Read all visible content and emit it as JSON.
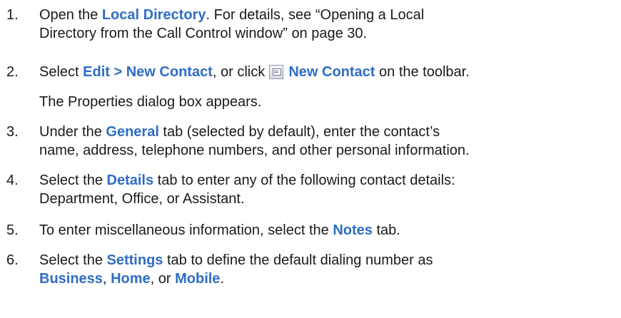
{
  "steps": [
    {
      "number": "1.",
      "lines": [
        [
          "Open the ",
          "Local Directory",
          ". For details, see “Opening a Local"
        ],
        [
          "Directory from the Call Control window” on page 30."
        ]
      ]
    },
    {
      "number": "2.",
      "text_a": "Select ",
      "ui_a": "Edit > New Contact",
      "text_b": ", or click ",
      "icon": "new-contact-icon",
      "ui_b": "New Contact",
      "text_c": " on the toolbar.",
      "note": "The Properties dialog box appears."
    },
    {
      "number": "3.",
      "pre": "Under the ",
      "ui": "General",
      "post": " tab (selected by default), enter the contact’s",
      "line2": "name, address, telephone numbers, and other personal information."
    },
    {
      "number": "4.",
      "pre": "Select the ",
      "ui": "Details",
      "post": " tab to enter any of the following contact details:",
      "line2": "Department, Office, or Assistant."
    },
    {
      "number": "5.",
      "pre": "To enter miscellaneous information, select the ",
      "ui": "Notes",
      "post": " tab."
    },
    {
      "number": "6.",
      "pre": "Select the ",
      "ui": "Settings",
      "post": " tab to define the default dialing number as",
      "opt1": "Business",
      "sep1": ", ",
      "opt2": "Home",
      "sep2": ", or ",
      "opt3": "Mobile",
      "end": "."
    }
  ]
}
